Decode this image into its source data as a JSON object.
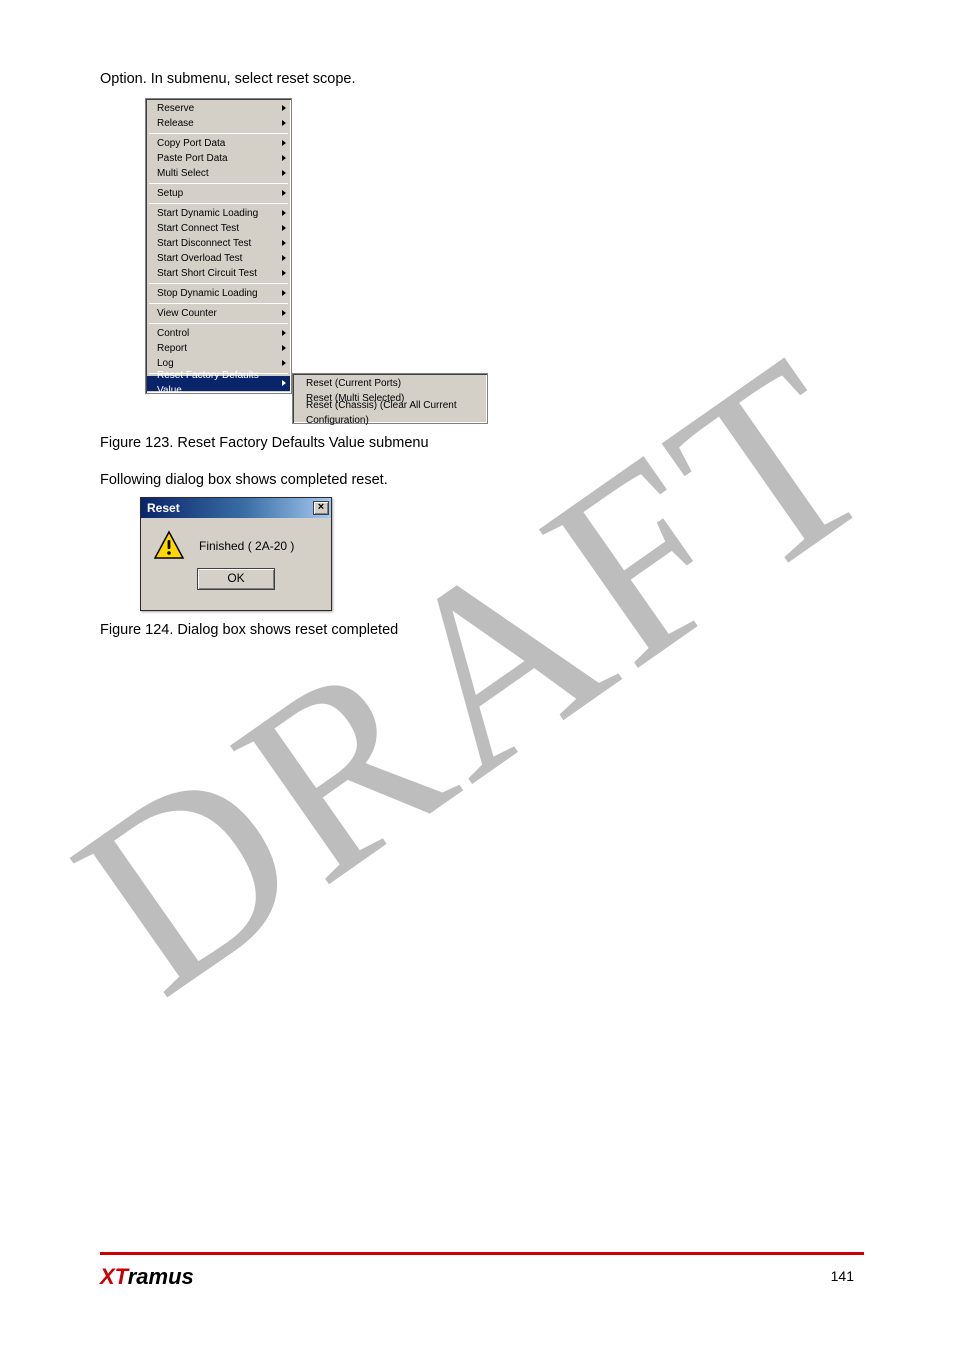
{
  "watermark": "DRAFT",
  "intro": "Option. In submenu, select reset scope.",
  "menu": {
    "groups": [
      {
        "items": [
          {
            "label": "Reserve",
            "sub": true
          },
          {
            "label": "Release",
            "sub": true
          }
        ]
      },
      {
        "items": [
          {
            "label": "Copy Port Data",
            "sub": true
          },
          {
            "label": "Paste Port Data",
            "sub": true
          },
          {
            "label": "Multi Select",
            "sub": true
          }
        ]
      },
      {
        "items": [
          {
            "label": "Setup",
            "sub": true
          }
        ]
      },
      {
        "items": [
          {
            "label": "Start Dynamic Loading",
            "sub": true
          },
          {
            "label": "Start Connect Test",
            "sub": true
          },
          {
            "label": "Start Disconnect Test",
            "sub": true
          },
          {
            "label": "Start Overload Test",
            "sub": true
          },
          {
            "label": "Start Short Circuit Test",
            "sub": true
          }
        ]
      },
      {
        "items": [
          {
            "label": "Stop Dynamic Loading",
            "sub": true
          }
        ]
      },
      {
        "items": [
          {
            "label": "View Counter",
            "sub": true
          }
        ]
      },
      {
        "items": [
          {
            "label": "Control",
            "sub": true
          },
          {
            "label": "Report",
            "sub": true
          },
          {
            "label": "Log",
            "sub": true
          }
        ]
      },
      {
        "items": [
          {
            "label": "Reset Factory Defaults Value",
            "sub": true,
            "highlight": true
          }
        ]
      }
    ],
    "submenu": [
      {
        "label": "Reset (Current Ports)"
      },
      {
        "label": "Reset (Multi Selected)"
      },
      {
        "label": "Reset (Chassis) (Clear All Current Configuration)"
      }
    ]
  },
  "fig1_caption": "Figure 123. Reset Factory Defaults Value submenu",
  "result_intro": "Following dialog box shows completed reset.",
  "dialog": {
    "title": "Reset",
    "close": "×",
    "message": "Finished ( 2A-20 )",
    "ok": "OK"
  },
  "fig2_caption": "Figure 124. Dialog box shows reset completed",
  "footer": {
    "brand_prefix": "XT",
    "brand_suffix": "ramus",
    "page": "141"
  }
}
